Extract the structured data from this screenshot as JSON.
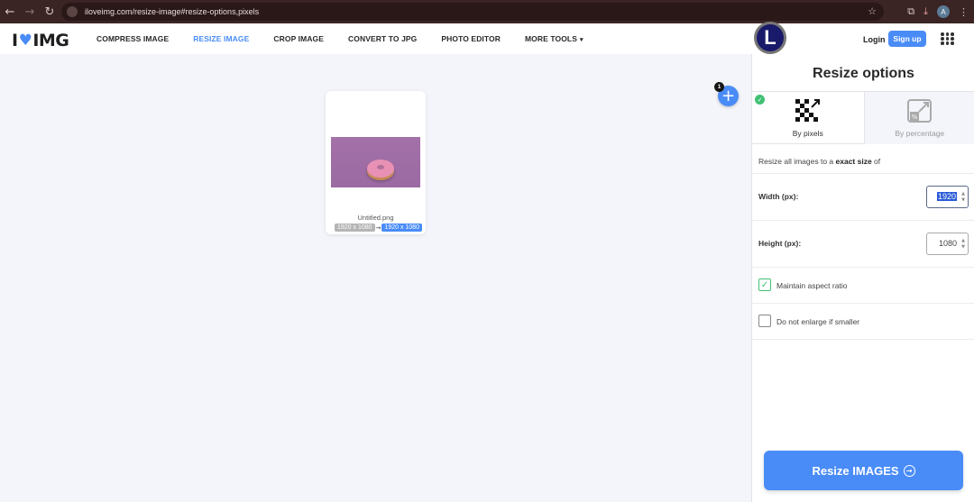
{
  "browser": {
    "url": "iloveimg.com/resize-image#resize-options,pixels",
    "profile_initial": "A",
    "back_icon": "←",
    "forward_icon": "→",
    "reload_icon": "↻",
    "star_icon": "☆",
    "ext_icon": "⧉",
    "download_icon": "⤓",
    "more_icon": "⋮"
  },
  "header": {
    "logo_left": "I",
    "logo_heart": "♥",
    "logo_right": "IMG",
    "menu": [
      {
        "label": "COMPRESS IMAGE",
        "active": false
      },
      {
        "label": "RESIZE IMAGE",
        "active": true
      },
      {
        "label": "CROP IMAGE",
        "active": false
      },
      {
        "label": "CONVERT TO JPG",
        "active": false
      },
      {
        "label": "PHOTO EDITOR",
        "active": false
      },
      {
        "label": "MORE TOOLS",
        "active": false
      }
    ],
    "more_caret": "▾",
    "avatar_letter": "L",
    "login": "Login",
    "signup": "Sign up"
  },
  "workspace": {
    "file": {
      "name": "Untitled.png",
      "original_size": "1920 x 1080",
      "arrow": "→",
      "new_size": "1920 x 1080"
    },
    "add_button": "+",
    "add_badge": "1"
  },
  "sidebar": {
    "title": "Resize options",
    "tabs": [
      {
        "label": "By pixels",
        "active": true
      },
      {
        "label": "By percentage",
        "active": false
      }
    ],
    "check_mark": "✓",
    "description_prefix": "Resize all images to a ",
    "description_bold": "exact size",
    "description_suffix": " of",
    "width_label": "Width (px):",
    "width_value": "1920",
    "height_label": "Height (px):",
    "height_value": "1080",
    "spin_up": "▲",
    "spin_down": "▼",
    "maintain_ratio_label": "Maintain aspect ratio",
    "maintain_ratio_checked": true,
    "no_enlarge_label": "Do not enlarge if smaller",
    "no_enlarge_checked": false,
    "action_button": "Resize IMAGES",
    "action_arrow": "→"
  },
  "colors": {
    "accent": "#4a8cf7",
    "success": "#41c074",
    "chrome": "#3a2424"
  }
}
